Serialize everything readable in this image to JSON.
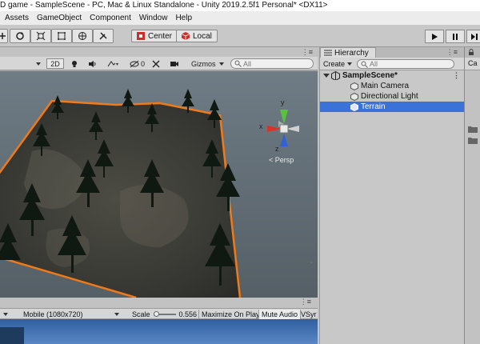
{
  "window": {
    "title": "D game - SampleScene - PC, Mac & Linux Standalone - Unity 2019.2.5f1 Personal* <DX11>"
  },
  "menu": [
    "Assets",
    "GameObject",
    "Component",
    "Window",
    "Help"
  ],
  "toolbar": {
    "pivot_label": "Center",
    "space_label": "Local"
  },
  "scene": {
    "mode_2d": "2D",
    "fx_count": "0",
    "gizmos_label": "Gizmos",
    "search_placeholder": "All",
    "persp_label": "Persp",
    "axis_x": "x",
    "axis_y": "y",
    "axis_z": "z"
  },
  "game": {
    "aspect_label": "Mobile (1080x720)",
    "scale_label": "Scale",
    "scale_value": "0.556",
    "maximize_label": "Maximize On Play",
    "mute_label": "Mute Audio",
    "vsync_label": "VSyr"
  },
  "hierarchy": {
    "tab_label": "Hierarchy",
    "create_label": "Create",
    "search_placeholder": "All",
    "scene_name": "SampleScene*",
    "items": [
      {
        "label": "Main Camera",
        "selected": false
      },
      {
        "label": "Directional Light",
        "selected": false
      },
      {
        "label": "Terrain",
        "selected": true
      }
    ]
  },
  "right_panel": {
    "label": "Ca"
  },
  "colors": {
    "selection": "#3a72d8",
    "terrain_outline": "#f07a18"
  }
}
